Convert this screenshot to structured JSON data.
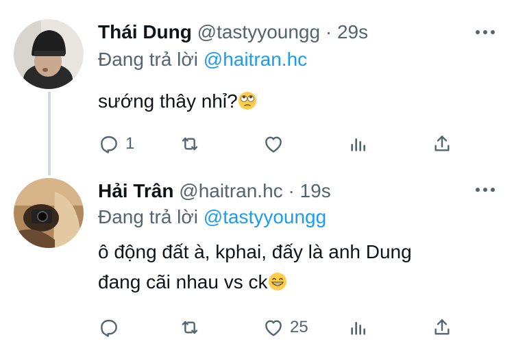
{
  "tweets": [
    {
      "name": "Thái Dung",
      "handle": "@tastyyoungg",
      "separator": "·",
      "time": "29s",
      "replying_prefix": "Đang trả lời",
      "replying_to": "@haitran.hc",
      "text": "sướng thây nhỉ?",
      "emoji": "eye-roll-emoji",
      "reply_count": "1",
      "retweet_count": "",
      "like_count": ""
    },
    {
      "name": "Hải Trân",
      "handle": "@haitran.hc",
      "separator": "·",
      "time": "19s",
      "replying_prefix": "Đang trả lời",
      "replying_to": "@tastyyoungg",
      "text_line1": "ô động đất à, kphai, đấy là anh Dung",
      "text_line2": "đang cãi nhau vs ck",
      "emoji": "grinning-emoji",
      "reply_count": "",
      "retweet_count": "",
      "like_count": "25"
    }
  ],
  "colors": {
    "text": "#0f1419",
    "muted": "#536471",
    "link": "#1d9bf0",
    "thread_line": "#cfd9de"
  },
  "icons": [
    "reply-icon",
    "retweet-icon",
    "like-icon",
    "views-icon",
    "share-icon",
    "more-icon"
  ]
}
